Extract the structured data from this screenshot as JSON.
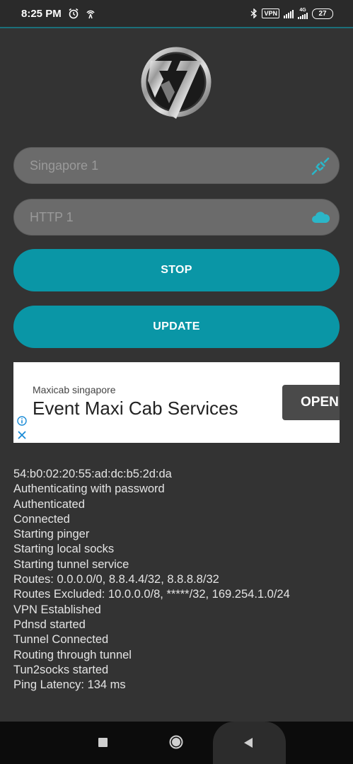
{
  "status_bar": {
    "time": "8:25 PM",
    "left_icons": [
      "alarm-icon",
      "hotspot-icon"
    ],
    "right_icons": [
      "bluetooth-icon",
      "vpn-icon",
      "signal-icon",
      "signal-4g-icon",
      "battery-icon"
    ],
    "vpn_label": "VPN",
    "network_label": "4G",
    "battery_level": "27"
  },
  "logo": {
    "icon": "sv-logo-icon"
  },
  "server_field": {
    "value": "Singapore 1",
    "icon": "plug-icon",
    "icon_color": "#2bb6c8"
  },
  "protocol_field": {
    "value": "HTTP 1",
    "icon": "cloud-icon",
    "icon_color": "#2bb6c8"
  },
  "buttons": {
    "stop_label": "STOP",
    "update_label": "UPDATE",
    "color": "#0a96a6"
  },
  "ad": {
    "advertiser": "Maxicab singapore",
    "headline": "Event Maxi Cab Services",
    "cta_label": "OPEN",
    "info_icon": "info-icon",
    "close_icon": "close-icon"
  },
  "log": [
    "54:b0:02:20:55:ad:dc:b5:2d:da",
    "Authenticating with password",
    "Authenticated",
    "Connected",
    "Starting pinger",
    "Starting local socks",
    "Starting tunnel service",
    "Routes: 0.0.0.0/0, 8.8.4.4/32, 8.8.8.8/32",
    "Routes Excluded: 10.0.0.0/8, *****/32, 169.254.1.0/24",
    "VPN Established",
    "Pdnsd started",
    "Tunnel Connected",
    "Routing through tunnel",
    "Tun2socks started",
    "Ping Latency: 134 ms"
  ],
  "nav_bar": {
    "icons": [
      "recents-icon",
      "home-icon",
      "back-icon"
    ]
  }
}
